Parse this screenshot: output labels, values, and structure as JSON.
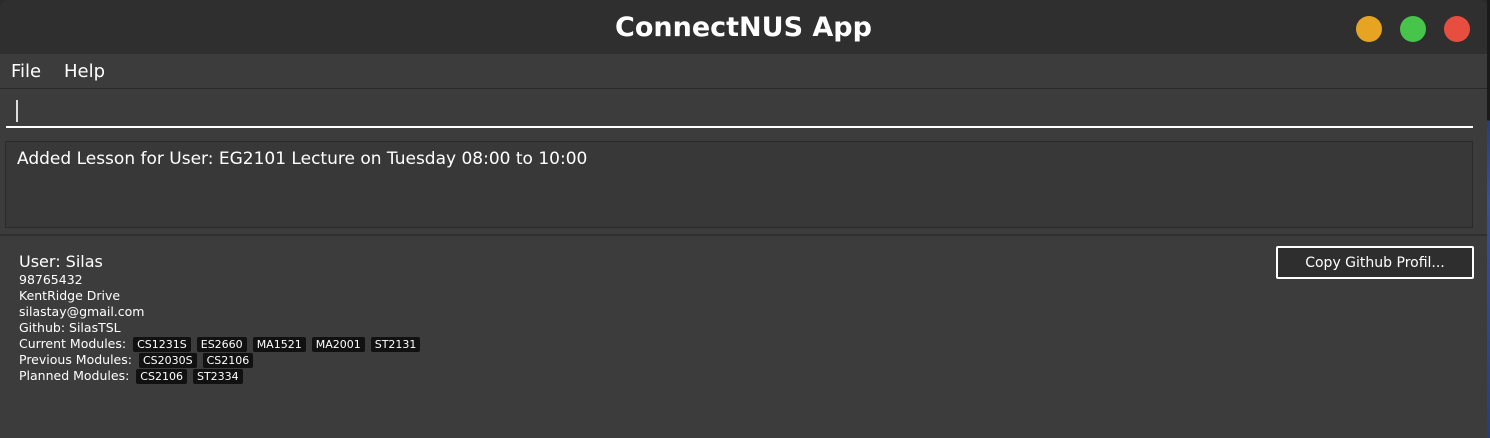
{
  "window": {
    "title": "ConnectNUS App"
  },
  "menu": {
    "items": [
      {
        "label": "File"
      },
      {
        "label": "Help"
      }
    ]
  },
  "command": {
    "value": "",
    "placeholder": ""
  },
  "result": {
    "message": "Added Lesson for User: EG2101 Lecture on Tuesday 08:00 to 10:00"
  },
  "user": {
    "name_label": "User:  Silas",
    "phone": "98765432",
    "address": "KentRidge Drive",
    "email": "silastay@gmail.com",
    "github": "Github: SilasTSL",
    "current_label": "Current Modules:",
    "current_modules": [
      "CS1231S",
      "ES2660",
      "MA1521",
      "MA2001",
      "ST2131"
    ],
    "previous_label": "Previous Modules:",
    "previous_modules": [
      "CS2030S",
      "CS2106"
    ],
    "planned_label": "Planned Modules:",
    "planned_modules": [
      "CS2106",
      "ST2334"
    ],
    "copy_button_label": "Copy Github Profil..."
  },
  "colors": {
    "background": "#3c3c3c",
    "titlebar": "#2f2f2f",
    "tag_background": "#111111",
    "minimize": "#e6a422",
    "maximize": "#47c44a",
    "close": "#e84e40"
  },
  "icons": {
    "minimize": "minimize-icon",
    "maximize": "maximize-icon",
    "close": "close-icon"
  }
}
